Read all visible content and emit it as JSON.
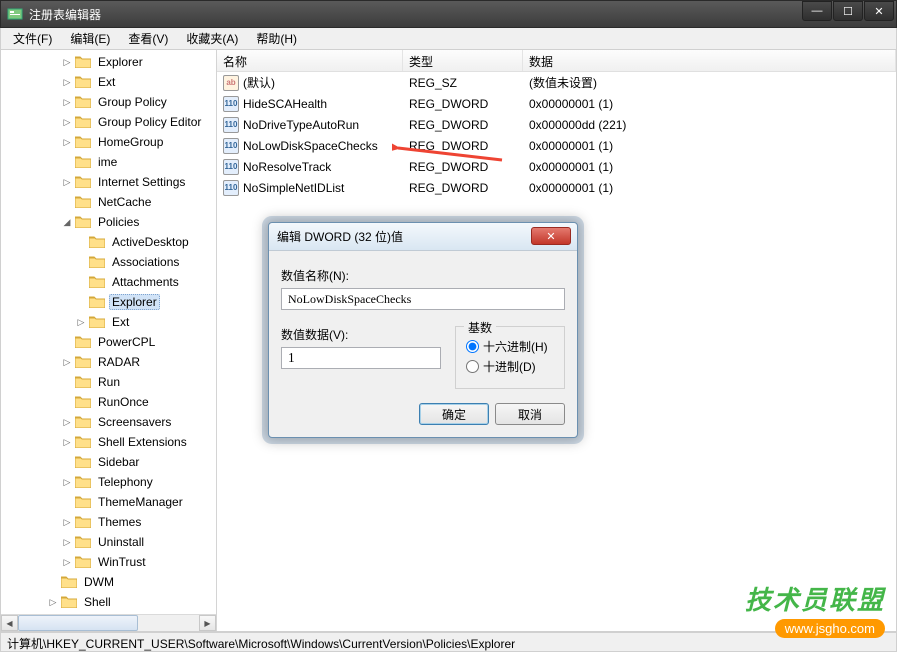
{
  "window": {
    "title": "注册表编辑器"
  },
  "menus": [
    "文件(F)",
    "编辑(E)",
    "查看(V)",
    "收藏夹(A)",
    "帮助(H)"
  ],
  "tree": [
    {
      "label": "Explorer",
      "depth": 4,
      "exp": "▷"
    },
    {
      "label": "Ext",
      "depth": 4,
      "exp": "▷"
    },
    {
      "label": "Group Policy",
      "depth": 4,
      "exp": "▷"
    },
    {
      "label": "Group Policy Editor",
      "depth": 4,
      "exp": "▷"
    },
    {
      "label": "HomeGroup",
      "depth": 4,
      "exp": "▷"
    },
    {
      "label": "ime",
      "depth": 4,
      "exp": ""
    },
    {
      "label": "Internet Settings",
      "depth": 4,
      "exp": "▷"
    },
    {
      "label": "NetCache",
      "depth": 4,
      "exp": ""
    },
    {
      "label": "Policies",
      "depth": 4,
      "exp": "◢"
    },
    {
      "label": "ActiveDesktop",
      "depth": 5,
      "exp": ""
    },
    {
      "label": "Associations",
      "depth": 5,
      "exp": ""
    },
    {
      "label": "Attachments",
      "depth": 5,
      "exp": ""
    },
    {
      "label": "Explorer",
      "depth": 5,
      "exp": "",
      "selected": true
    },
    {
      "label": "Ext",
      "depth": 5,
      "exp": "▷"
    },
    {
      "label": "PowerCPL",
      "depth": 4,
      "exp": ""
    },
    {
      "label": "RADAR",
      "depth": 4,
      "exp": "▷"
    },
    {
      "label": "Run",
      "depth": 4,
      "exp": ""
    },
    {
      "label": "RunOnce",
      "depth": 4,
      "exp": ""
    },
    {
      "label": "Screensavers",
      "depth": 4,
      "exp": "▷"
    },
    {
      "label": "Shell Extensions",
      "depth": 4,
      "exp": "▷"
    },
    {
      "label": "Sidebar",
      "depth": 4,
      "exp": ""
    },
    {
      "label": "Telephony",
      "depth": 4,
      "exp": "▷"
    },
    {
      "label": "ThemeManager",
      "depth": 4,
      "exp": ""
    },
    {
      "label": "Themes",
      "depth": 4,
      "exp": "▷"
    },
    {
      "label": "Uninstall",
      "depth": 4,
      "exp": "▷"
    },
    {
      "label": "WinTrust",
      "depth": 4,
      "exp": "▷"
    },
    {
      "label": "DWM",
      "depth": 3,
      "exp": ""
    },
    {
      "label": "Shell",
      "depth": 3,
      "exp": "▷"
    }
  ],
  "list": {
    "headers": {
      "name": "名称",
      "type": "类型",
      "data": "数据"
    },
    "rows": [
      {
        "icon": "sz",
        "name": "(默认)",
        "type": "REG_SZ",
        "data": "(数值未设置)"
      },
      {
        "icon": "dw",
        "name": "HideSCAHealth",
        "type": "REG_DWORD",
        "data": "0x00000001 (1)"
      },
      {
        "icon": "dw",
        "name": "NoDriveTypeAutoRun",
        "type": "REG_DWORD",
        "data": "0x000000dd (221)"
      },
      {
        "icon": "dw",
        "name": "NoLowDiskSpaceChecks",
        "type": "REG_DWORD",
        "data": "0x00000001 (1)"
      },
      {
        "icon": "dw",
        "name": "NoResolveTrack",
        "type": "REG_DWORD",
        "data": "0x00000001 (1)"
      },
      {
        "icon": "dw",
        "name": "NoSimpleNetIDList",
        "type": "REG_DWORD",
        "data": "0x00000001 (1)"
      }
    ]
  },
  "dialog": {
    "title": "编辑 DWORD (32 位)值",
    "name_label": "数值名称(N):",
    "name_value": "NoLowDiskSpaceChecks",
    "data_label": "数值数据(V):",
    "data_value": "1",
    "base_label": "基数",
    "radio_hex": "十六进制(H)",
    "radio_dec": "十进制(D)",
    "ok": "确定",
    "cancel": "取消"
  },
  "statusbar": "计算机\\HKEY_CURRENT_USER\\Software\\Microsoft\\Windows\\CurrentVersion\\Policies\\Explorer",
  "watermark": {
    "line1": "技术员联盟",
    "line2": "www.jsgho.com"
  },
  "icons": {
    "sz_text": "ab",
    "dw_text": "110"
  }
}
